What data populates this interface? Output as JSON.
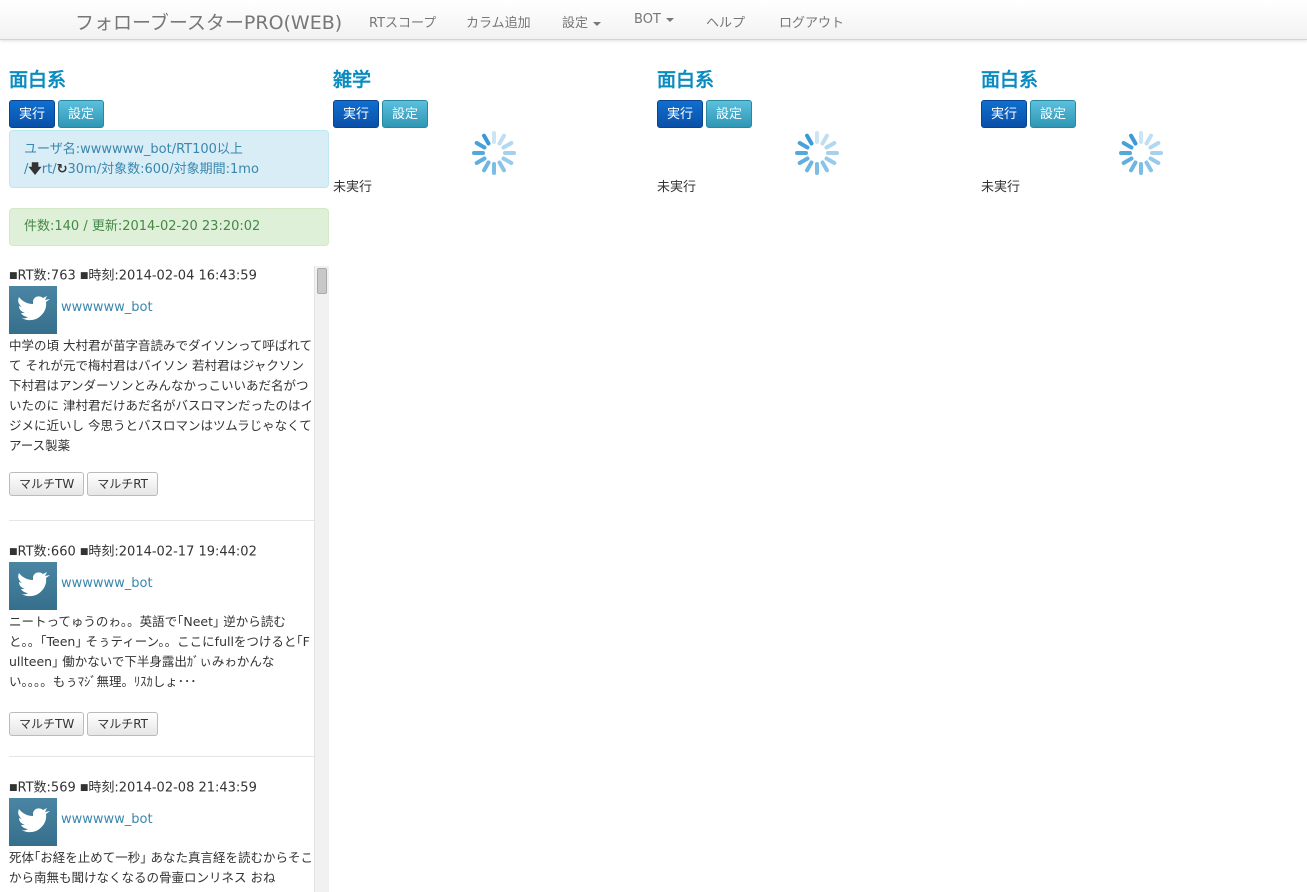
{
  "navbar": {
    "brand": "フォローブースターPRO(WEB)",
    "items": [
      {
        "label": "RTスコープ",
        "dropdown": false
      },
      {
        "label": "カラム追加",
        "dropdown": false
      },
      {
        "label": "設定",
        "dropdown": true
      },
      {
        "label": "BOT",
        "dropdown": true
      },
      {
        "label": "ヘルプ",
        "dropdown": false
      },
      {
        "label": "ログアウト",
        "dropdown": false
      }
    ]
  },
  "buttons": {
    "run": "実行",
    "settings": "設定"
  },
  "columns": [
    {
      "title": "面白系"
    },
    {
      "title": "雑学",
      "status": "未実行"
    },
    {
      "title": "面白系",
      "status": "未実行"
    },
    {
      "title": "面白系",
      "status": "未実行"
    }
  ],
  "column1": {
    "info_line1": "ユーザ名:wwwwww_bot/RT100以上",
    "info_line2_prefix": "/",
    "info_line2_rt": "rt/",
    "info_line2_rest": "30m/対象数:600/対象期間:1mo",
    "success": "件数:140 / 更新:2014-02-20 23:20:02"
  },
  "tweet_buttons": {
    "multi_tw": "マルチTW",
    "multi_rt": "マルチRT"
  },
  "tweets": [
    {
      "rt_label": "RT数:763",
      "time_label": "時刻:2014-02-04 16:43:59",
      "username": "wwwwww_bot",
      "text": "中学の頃 大村君が苗字音読みでダイソンって呼ばれてて それが元で梅村君はバイソン 若村君はジャクソン 下村君はアンダーソンとみんなかっこいいあだ名がついたのに 津村君だけあだ名がバスロマンだったのはイジメに近いし 今思うとバスロマンはツムラじゃなくてアース製薬"
    },
    {
      "rt_label": "RT数:660",
      "time_label": "時刻:2014-02-17 19:44:02",
      "username": "wwwwww_bot",
      "text": "ニートってゅうのゎ。。英語で｢Neet｣ 逆から読むと。。｢Teen｣ そぅティーン。。ここにfullをつけると｢Fullteen｣ 働かないで下半身露出ｶﾞぃみゎかんない。。。。もぅﾏｼﾞ無理。ﾘｽｶしょ･･･"
    },
    {
      "rt_label": "RT数:569",
      "time_label": "時刻:2014-02-08 21:43:59",
      "username": "wwwwww_bot",
      "text": "死体｢お経を止めて一秒｣ あなた真言経を読むからそこから南無も聞けなくなるの骨壷ロンリネス おね"
    }
  ]
}
